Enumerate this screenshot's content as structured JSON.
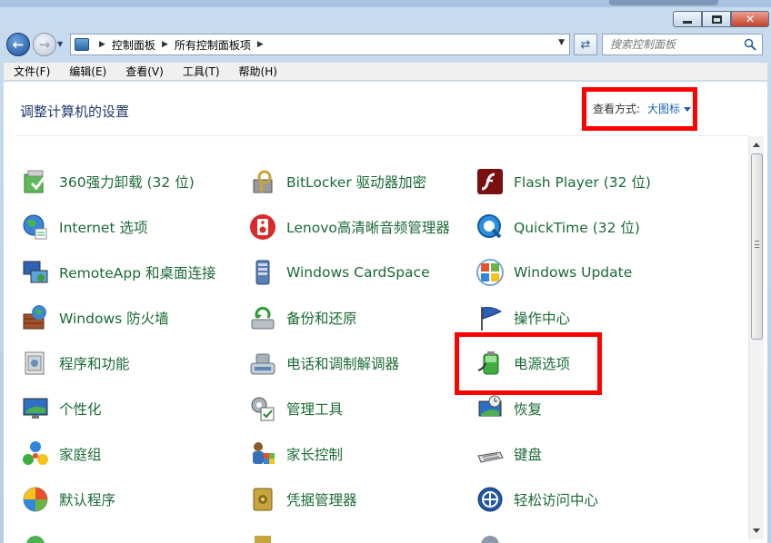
{
  "nav": {
    "back_icon": "back-arrow-icon",
    "forward_icon": "forward-arrow-icon",
    "breadcrumbs": [
      "控制面板",
      "所有控制面板项"
    ],
    "search_placeholder": "搜索控制面板"
  },
  "menu": [
    "文件(F)",
    "编辑(E)",
    "查看(V)",
    "工具(T)",
    "帮助(H)"
  ],
  "header": {
    "title": "调整计算机的设置",
    "view_label": "查看方式:",
    "view_value": "大图标"
  },
  "items": [
    {
      "label": "360强力卸载 (32 位)",
      "icon": "uninstall-box-icon"
    },
    {
      "label": "BitLocker 驱动器加密",
      "icon": "bitlocker-key-icon"
    },
    {
      "label": "Flash Player (32 位)",
      "icon": "flash-player-icon"
    },
    {
      "label": "Internet 选项",
      "icon": "internet-globe-icon"
    },
    {
      "label": "Lenovo高清晰音频管理器",
      "icon": "speaker-icon"
    },
    {
      "label": "QuickTime (32 位)",
      "icon": "quicktime-icon"
    },
    {
      "label": "RemoteApp 和桌面连接",
      "icon": "remote-desktop-icon"
    },
    {
      "label": "Windows CardSpace",
      "icon": "cardspace-icon"
    },
    {
      "label": "Windows Update",
      "icon": "windows-update-icon"
    },
    {
      "label": "Windows 防火墙",
      "icon": "firewall-icon"
    },
    {
      "label": "备份和还原",
      "icon": "backup-restore-icon"
    },
    {
      "label": "操作中心",
      "icon": "action-center-flag-icon"
    },
    {
      "label": "程序和功能",
      "icon": "programs-features-icon"
    },
    {
      "label": "电话和调制解调器",
      "icon": "phone-modem-icon"
    },
    {
      "label": "电源选项",
      "icon": "power-battery-icon"
    },
    {
      "label": "个性化",
      "icon": "personalization-icon"
    },
    {
      "label": "管理工具",
      "icon": "admin-tools-icon"
    },
    {
      "label": "恢复",
      "icon": "recovery-icon"
    },
    {
      "label": "家庭组",
      "icon": "homegroup-icon"
    },
    {
      "label": "家长控制",
      "icon": "parental-controls-icon"
    },
    {
      "label": "键盘",
      "icon": "keyboard-icon"
    },
    {
      "label": "默认程序",
      "icon": "default-programs-icon"
    },
    {
      "label": "凭据管理器",
      "icon": "credential-vault-icon"
    },
    {
      "label": "轻松访问中心",
      "icon": "ease-of-access-icon"
    }
  ],
  "colors": {
    "item_text": "#1b6b34",
    "highlight": "#ff0000",
    "title": "#1e3a6e"
  }
}
